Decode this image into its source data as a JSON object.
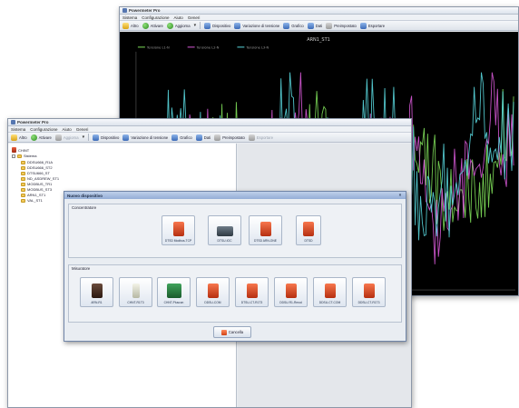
{
  "chart_window": {
    "title": "Powermeter Pro",
    "menu": [
      "Sistema",
      "Configurazione",
      "Aiuto",
      "Generi"
    ],
    "toolbar": [
      {
        "label": "Altro",
        "icon": "gear-icon"
      },
      {
        "label": "Attivare",
        "icon": "play-icon"
      },
      {
        "label": "Aggiorna",
        "icon": "refresh-icon"
      },
      {
        "label": "Dispositivo",
        "icon": "device-icon"
      },
      {
        "label": "Variazione di tensione",
        "icon": "chart-icon"
      },
      {
        "label": "Grafico",
        "icon": "graph-icon"
      },
      {
        "label": "Dati",
        "icon": "table-icon"
      },
      {
        "label": "Preimpostato",
        "icon": "wrench-icon"
      },
      {
        "label": "Esportare",
        "icon": "export-icon"
      }
    ],
    "chart_title": "ARN1_ST1",
    "legend": [
      "Tensione L1-N",
      "Tensione L2-N",
      "Tensione L3-N"
    ]
  },
  "main_window": {
    "title": "Powermeter Pro",
    "menu": [
      "Sistema",
      "Configurazione",
      "Aiuto",
      "Generi"
    ],
    "toolbar": [
      {
        "label": "Altro",
        "icon": "gear-icon",
        "enabled": true
      },
      {
        "label": "Attivare",
        "icon": "play-icon",
        "enabled": true
      },
      {
        "label": "Aggiorna",
        "icon": "refresh-icon",
        "enabled": false
      },
      {
        "label": "Dispositivo",
        "icon": "device-icon",
        "enabled": true
      },
      {
        "label": "Variazione di tensione",
        "icon": "chart-icon",
        "enabled": true
      },
      {
        "label": "Grafico",
        "icon": "graph-icon",
        "enabled": true
      },
      {
        "label": "Dati",
        "icon": "table-icon",
        "enabled": true
      },
      {
        "label": "Preimpostato",
        "icon": "wrench-icon",
        "enabled": true
      },
      {
        "label": "Esportare",
        "icon": "export-icon",
        "enabled": false
      }
    ],
    "tree": {
      "root": "CHINT",
      "child": "Sistema",
      "items": [
        "DDSU666_R1A",
        "DDSU666_ST2",
        "DTSU666_ST",
        "ND_ASDREW_ST1",
        "MODBUS_TR1",
        "MODBUS_ST3",
        "ARN1_ST1",
        "VAL_ST1"
      ]
    }
  },
  "dialog": {
    "title": "Nuovo dispositivo",
    "concentrators_label": "Concentratore",
    "concentrators": [
      {
        "caption": "DTSD Modbus-TCP",
        "style": "red"
      },
      {
        "caption": "DTSU-IOC",
        "style": "dark"
      },
      {
        "caption": "DTSD ARN-ONE",
        "style": "red"
      },
      {
        "caption": "DTSD",
        "style": "red"
      }
    ],
    "meters_label": "Misuratore",
    "meters": [
      {
        "caption": "ARN-R1",
        "style": "amber"
      },
      {
        "caption": "CHNT-R1T3",
        "style": "pale"
      },
      {
        "caption": "CHNT-Pluscon",
        "style": "greenbox"
      },
      {
        "caption": "DDSU-COM",
        "style": "red"
      },
      {
        "caption": "DTSU-CT-R1T3",
        "style": "red"
      },
      {
        "caption": "DDSU-R1-Rmod",
        "style": "red"
      },
      {
        "caption": "DDSU-CT-COM",
        "style": "red"
      },
      {
        "caption": "DDSU-CT-R1T3",
        "style": "red"
      }
    ],
    "cancel_label": "Cancella"
  },
  "colors": {
    "chart_background": "#000000",
    "series": [
      "#7fe05a",
      "#d95ad9",
      "#5ad9e0"
    ]
  }
}
